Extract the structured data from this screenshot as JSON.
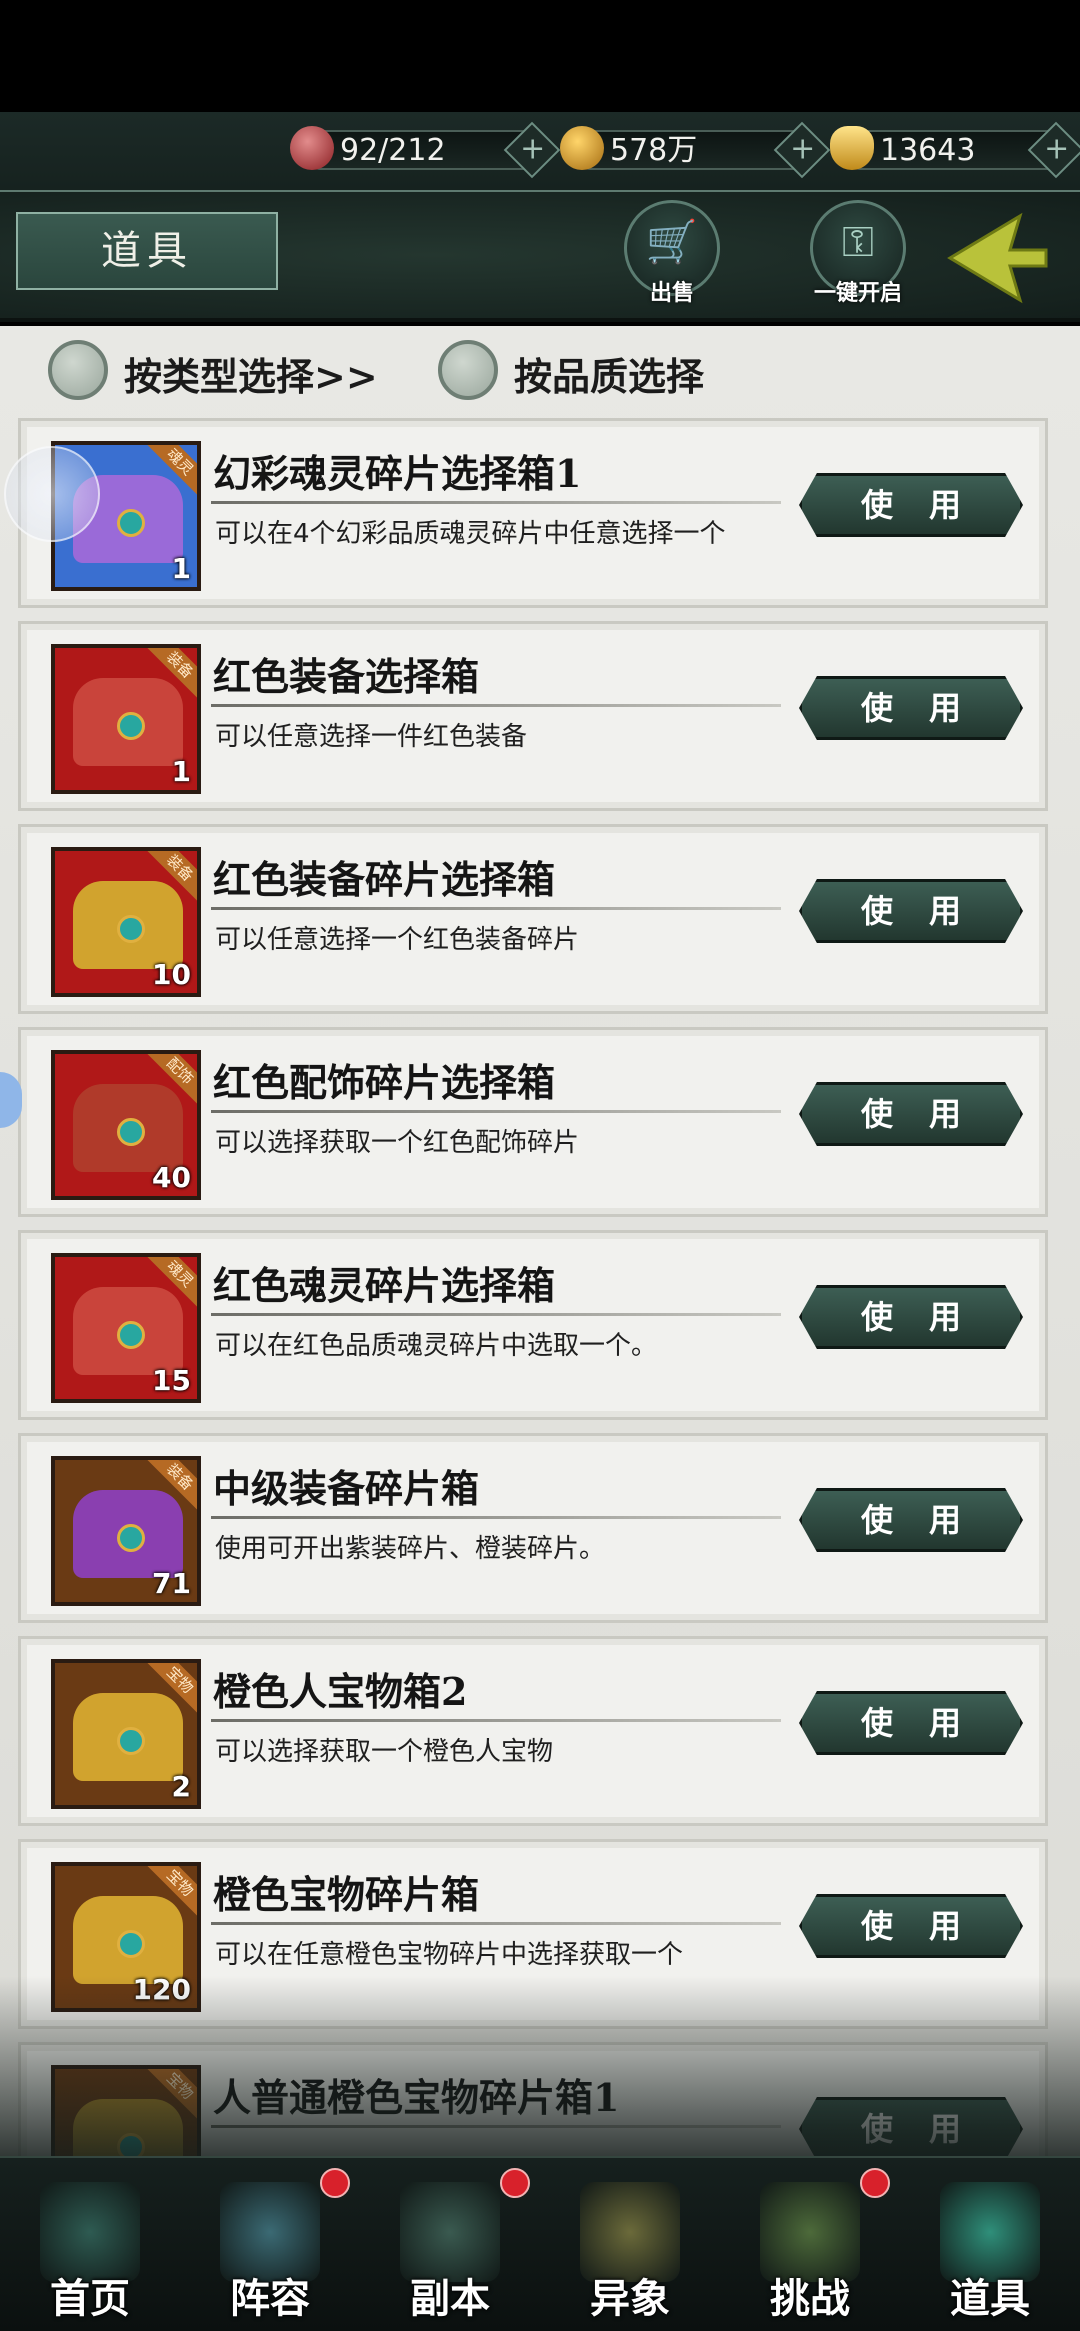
{
  "resources": [
    {
      "icon": "stamina-orb-icon",
      "value": "92/212"
    },
    {
      "icon": "coin-icon",
      "value": "578万"
    },
    {
      "icon": "gold-ingot-icon",
      "value": "13643"
    }
  ],
  "header": {
    "title": "道具",
    "sell_label": "出售",
    "open_all_label": "一键开启"
  },
  "filters": {
    "by_type": "按类型选择>>",
    "by_quality": "按品质选择"
  },
  "use_label": "使用",
  "items": [
    {
      "name": "幻彩魂灵碎片选择箱1",
      "desc": "可以在4个幻彩品质魂灵碎片中任意选择一个",
      "count": "1",
      "tag": "魂灵",
      "bg": "#3a6fd0",
      "chest": "#9a6ad8"
    },
    {
      "name": "红色装备选择箱",
      "desc": "可以任意选择一件红色装备",
      "count": "1",
      "tag": "装备",
      "bg": "#b01818",
      "chest": "#c9443b"
    },
    {
      "name": "红色装备碎片选择箱",
      "desc": "可以任意选择一个红色装备碎片",
      "count": "10",
      "tag": "装备",
      "bg": "#b01818",
      "chest": "#d1a32e"
    },
    {
      "name": "红色配饰碎片选择箱",
      "desc": "可以选择获取一个红色配饰碎片",
      "count": "40",
      "tag": "配饰",
      "bg": "#b01818",
      "chest": "#b03a2a"
    },
    {
      "name": "红色魂灵碎片选择箱",
      "desc": "可以在红色品质魂灵碎片中选取一个。",
      "count": "15",
      "tag": "魂灵",
      "bg": "#b01818",
      "chest": "#c9443b"
    },
    {
      "name": "中级装备碎片箱",
      "desc": "使用可开出紫装碎片、橙装碎片。",
      "count": "71",
      "tag": "装备",
      "bg": "#6a3a14",
      "chest": "#8a3fb0"
    },
    {
      "name": "橙色人宝物箱2",
      "desc": "可以选择获取一个橙色人宝物",
      "count": "2",
      "tag": "宝物",
      "bg": "#6a3a14",
      "chest": "#d1a32e"
    },
    {
      "name": "橙色宝物碎片箱",
      "desc": "可以在任意橙色宝物碎片中选择获取一个",
      "count": "120",
      "tag": "宝物",
      "bg": "#6a3a14",
      "chest": "#d1a32e"
    },
    {
      "name": "人普通橙色宝物碎片箱1",
      "desc": "",
      "count": "",
      "tag": "宝物",
      "bg": "#6a3a14",
      "chest": "#b8902a"
    }
  ],
  "nav": [
    {
      "label": "首页",
      "badge": false
    },
    {
      "label": "阵容",
      "badge": true
    },
    {
      "label": "副本",
      "badge": true
    },
    {
      "label": "异象",
      "badge": false
    },
    {
      "label": "挑战",
      "badge": true
    },
    {
      "label": "道具",
      "badge": false,
      "active": true
    }
  ]
}
